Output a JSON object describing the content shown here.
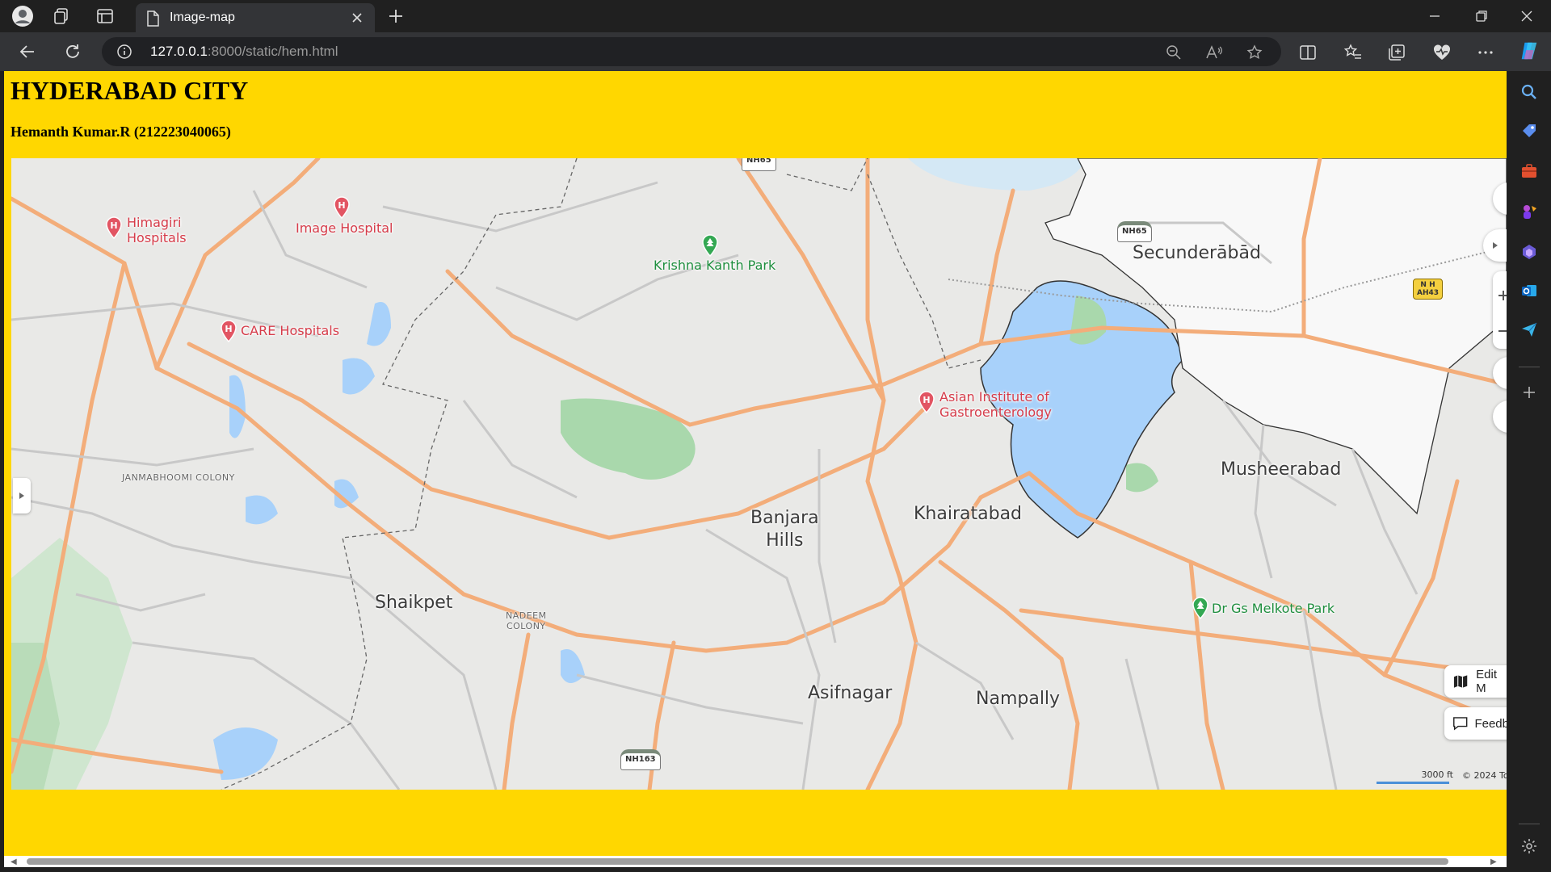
{
  "browser": {
    "tab_title": "Image-map",
    "url_host": "127.0.0.1",
    "url_rest": ":8000/static/hem.html"
  },
  "page": {
    "heading": "HYDERABAD CITY",
    "subheading": "Hemanth Kumar.R (212223040065)",
    "background_color": "#FFD700"
  },
  "map": {
    "areas": [
      {
        "id": "secunderabad",
        "name": "Secunderābād"
      },
      {
        "id": "musheerabad",
        "name": "Musheerabad"
      },
      {
        "id": "khairatabad",
        "name": "Khairatabad"
      },
      {
        "id": "banjara",
        "name": "Banjara\nHills"
      },
      {
        "id": "shaikpet",
        "name": "Shaikpet"
      },
      {
        "id": "asifnagar",
        "name": "Asifnagar"
      },
      {
        "id": "nampally",
        "name": "Nampally"
      }
    ],
    "small_labels": [
      {
        "id": "janmabhoomi",
        "name": "JANMABHOOMI COLONY"
      },
      {
        "id": "nadeem",
        "name": "NADEEM\nCOLONY"
      }
    ],
    "hospitals": [
      {
        "id": "himagiri",
        "name": "Himagiri\nHospitals"
      },
      {
        "id": "image",
        "name": "Image Hospital"
      },
      {
        "id": "care",
        "name": "CARE Hospitals"
      },
      {
        "id": "asian",
        "name": "Asian Institute of\nGastroenterology"
      }
    ],
    "parks": [
      {
        "id": "krishna",
        "name": "Krishna Kanth Park"
      },
      {
        "id": "melkote",
        "name": "Dr Gs Melkote Park"
      }
    ],
    "road_shields": {
      "nh65": "NH65",
      "nh163": "NH163",
      "nh65_top": "NH65",
      "ah43": "N H\nAH43"
    },
    "buttons": {
      "edit": "Edit M",
      "feedback": "Feedb"
    },
    "scale": "3000 ft",
    "attribution": "© 2024 To"
  }
}
